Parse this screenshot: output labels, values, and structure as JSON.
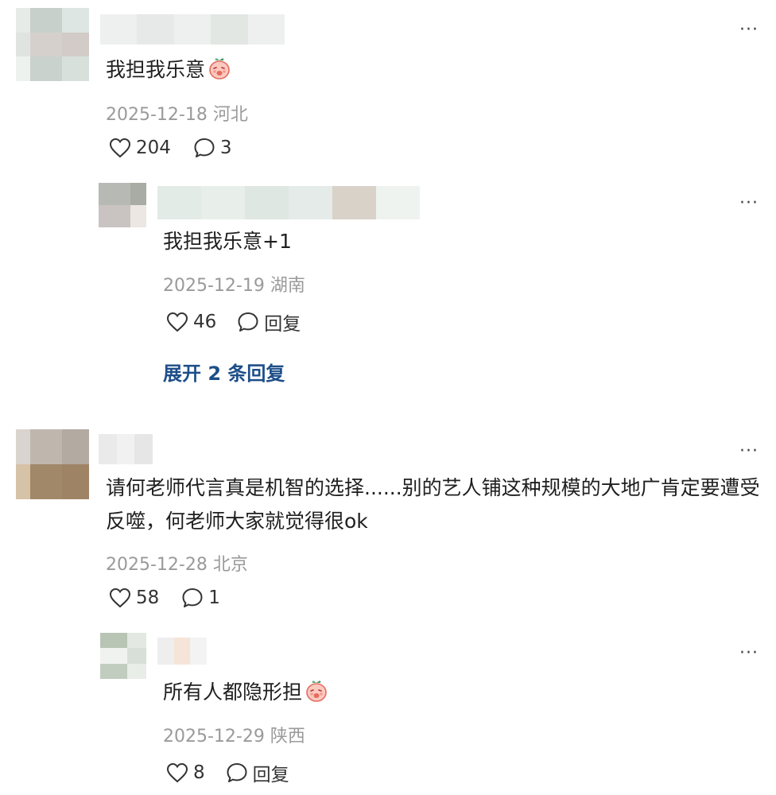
{
  "comments": [
    {
      "text": "我担我乐意",
      "emoji": "peach-face-emoji",
      "date": "2025-12-18",
      "location": "河北",
      "likes": "204",
      "replies": "3",
      "sub": {
        "text": "我担我乐意+1",
        "date": "2025-12-19",
        "location": "湖南",
        "likes": "46",
        "reply_label": "回复"
      },
      "expand_label": "展开 2 条回复"
    },
    {
      "text": "请何老师代言真是机智的选择......别的艺人铺这种规模的大地广肯定要遭受反噬，何老师大家就觉得很ok",
      "date": "2025-12-28",
      "location": "北京",
      "likes": "58",
      "replies": "1",
      "sub": {
        "text": "所有人都隐形担",
        "emoji": "peach-face-emoji",
        "date": "2025-12-29",
        "location": "陕西",
        "likes": "8",
        "reply_label": "回复"
      }
    }
  ],
  "more_label": "···",
  "colors": {
    "link": "#1d4e89",
    "meta": "#9a9a9a"
  }
}
